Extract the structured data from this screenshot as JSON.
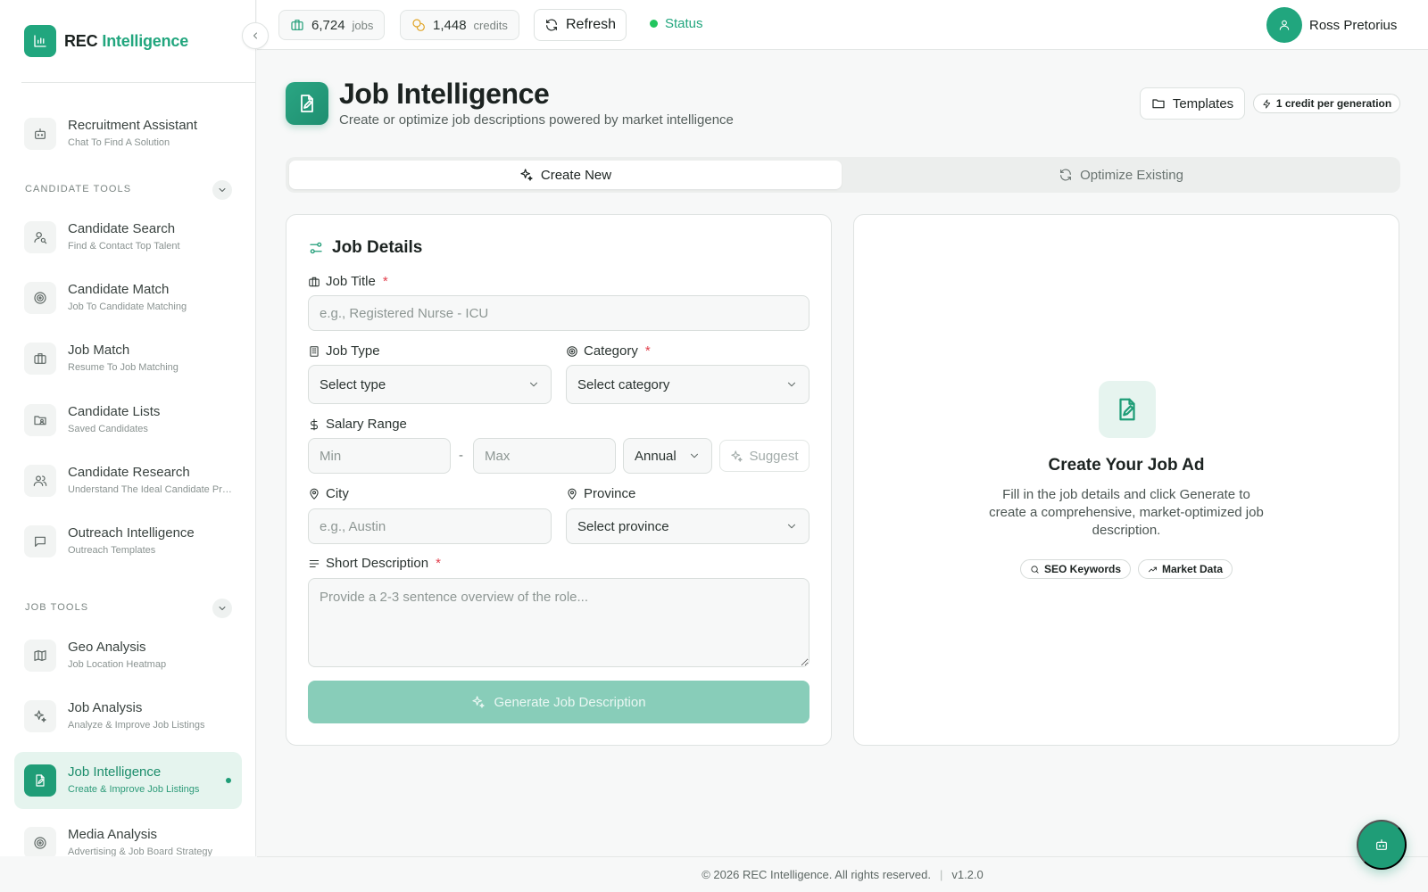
{
  "brand": {
    "prefix": "REC",
    "accent": "Intelligence",
    "logo_icon": "bar-chart-icon"
  },
  "sidebar": {
    "top_items": [
      {
        "title": "Recruitment Assistant",
        "subtitle": "Chat To Find A Solution",
        "icon": "bot-icon"
      }
    ],
    "sections": [
      {
        "label": "CANDIDATE TOOLS",
        "items": [
          {
            "title": "Candidate Search",
            "subtitle": "Find & Contact Top Talent",
            "icon": "user-search-icon"
          },
          {
            "title": "Candidate Match",
            "subtitle": "Job To Candidate Matching",
            "icon": "target-icon"
          },
          {
            "title": "Job Match",
            "subtitle": "Resume To Job Matching",
            "icon": "briefcase-icon"
          },
          {
            "title": "Candidate Lists",
            "subtitle": "Saved Candidates",
            "icon": "folder-user-icon"
          },
          {
            "title": "Candidate Research",
            "subtitle": "Understand The Ideal Candidate Pro...",
            "icon": "users-icon"
          },
          {
            "title": "Outreach Intelligence",
            "subtitle": "Outreach Templates",
            "icon": "message-icon"
          }
        ]
      },
      {
        "label": "JOB TOOLS",
        "items": [
          {
            "title": "Geo Analysis",
            "subtitle": "Job Location Heatmap",
            "icon": "map-icon"
          },
          {
            "title": "Job Analysis",
            "subtitle": "Analyze & Improve Job Listings",
            "icon": "sparkles-icon"
          },
          {
            "title": "Job Intelligence",
            "subtitle": "Create & Improve Job Listings",
            "icon": "file-pen-icon",
            "active": true
          },
          {
            "title": "Media Analysis",
            "subtitle": "Advertising & Job Board Strategy",
            "icon": "target-icon"
          }
        ]
      }
    ]
  },
  "topbar": {
    "jobs_count": "6,724",
    "jobs_label": "jobs",
    "credits_count": "1,448",
    "credits_label": "credits",
    "refresh_label": "Refresh",
    "status_label": "Status",
    "user_name": "Ross Pretorius"
  },
  "page": {
    "title": "Job Intelligence",
    "subtitle": "Create or optimize job descriptions powered by market intelligence",
    "templates_label": "Templates",
    "credit_badge": "1 credit per generation"
  },
  "tabs": {
    "create": "Create New",
    "optimize": "Optimize Existing"
  },
  "form": {
    "card_title": "Job Details",
    "job_title": {
      "label": "Job Title",
      "required": "*",
      "placeholder": "e.g., Registered Nurse - ICU",
      "value": ""
    },
    "job_type": {
      "label": "Job Type",
      "value": "Select type"
    },
    "category": {
      "label": "Category",
      "required": "*",
      "value": "Select category"
    },
    "salary": {
      "label": "Salary Range",
      "min_placeholder": "Min",
      "max_placeholder": "Max",
      "separator": "-",
      "period": "Annual",
      "suggest_label": "Suggest"
    },
    "city": {
      "label": "City",
      "placeholder": "e.g., Austin",
      "value": ""
    },
    "province": {
      "label": "Province",
      "value": "Select province"
    },
    "description": {
      "label": "Short Description",
      "required": "*",
      "placeholder": "Provide a 2-3 sentence overview of the role...",
      "value": ""
    },
    "generate_label": "Generate Job Description"
  },
  "preview": {
    "title": "Create Your Job Ad",
    "text": "Fill in the job details and click Generate to create a comprehensive, market-optimized job description.",
    "chips": [
      "SEO Keywords",
      "Market Data"
    ]
  },
  "footer": {
    "copyright": "© 2026 REC Intelligence. All rights reserved.",
    "divider": "|",
    "version": "v1.2.0"
  },
  "colors": {
    "accent": "#21a67e",
    "accent_light": "#e5f4ee",
    "required": "#e2404d",
    "status": "#22c55e"
  }
}
